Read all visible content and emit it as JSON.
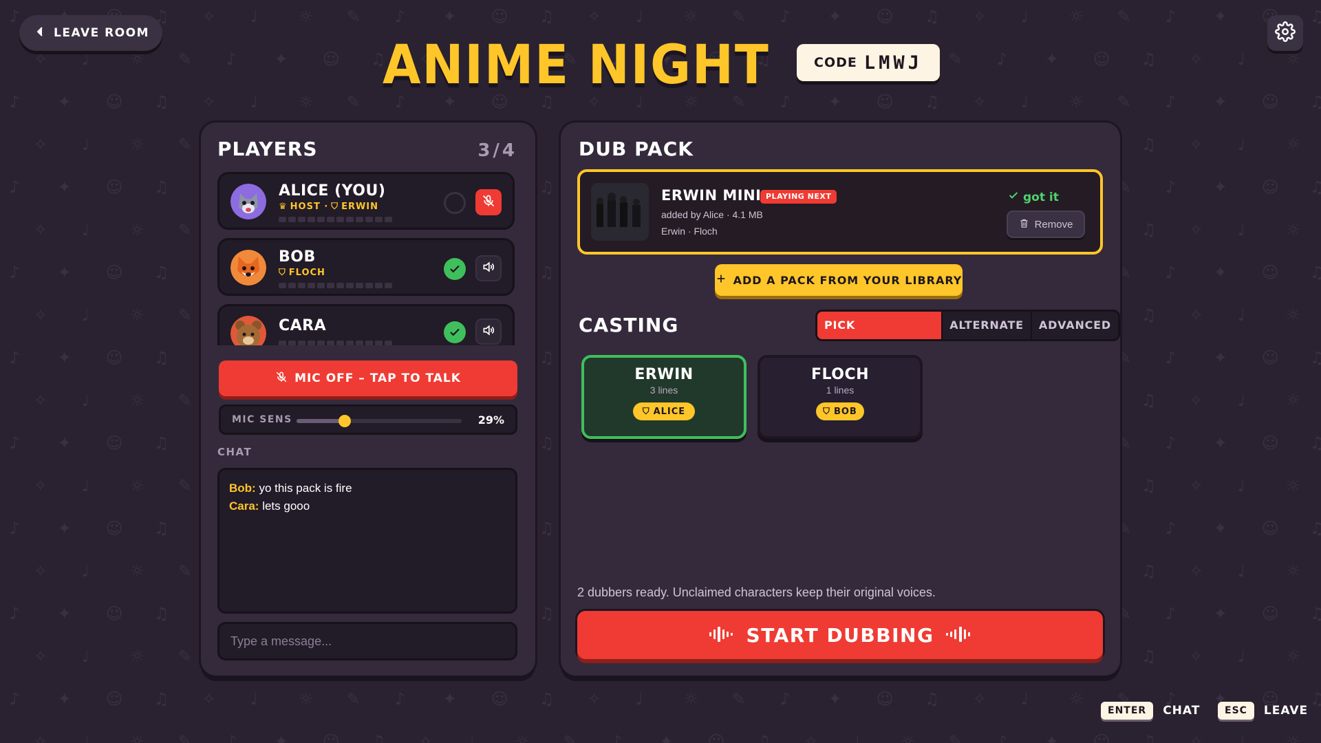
{
  "header": {
    "leave_label": "LEAVE ROOM",
    "title": "ANIME NIGHT",
    "code_label": "CODE",
    "code_value": "LMWJ"
  },
  "players": {
    "heading": "PLAYERS",
    "count": "3/4",
    "list": [
      {
        "name": "ALICE (YOU)",
        "role": "HOST · ",
        "character": "ERWIN",
        "ready": false,
        "mic": "muted"
      },
      {
        "name": "BOB",
        "role": "",
        "character": "FLOCH",
        "ready": true,
        "mic": "speaker"
      },
      {
        "name": "CARA",
        "role": "",
        "character": "",
        "ready": true,
        "mic": "speaker"
      }
    ],
    "mic_button_label": "MIC OFF – TAP TO TALK",
    "mic_sens_label": "MIC SENS",
    "mic_sens_value": "29%",
    "mic_sens_fraction": 0.29
  },
  "chat": {
    "label": "CHAT",
    "messages": [
      {
        "author": "Bob:",
        "text": " yo this pack is fire"
      },
      {
        "author": "Cara:",
        "text": " lets gooo"
      }
    ],
    "placeholder": "Type a message..."
  },
  "dub_pack": {
    "heading": "DUB PACK",
    "pack": {
      "name": "ERWIN MINI",
      "badge": "PLAYING NEXT",
      "meta": "added by Alice · 4.1 MB",
      "characters": "Erwin · Floch",
      "status": "got it",
      "remove_label": "Remove"
    },
    "add_label": "ADD A PACK FROM YOUR LIBRARY"
  },
  "casting": {
    "heading": "CASTING",
    "tabs": [
      {
        "label": "PICK CHARACTERS",
        "active": true
      },
      {
        "label": "ALTERNATE",
        "active": false
      },
      {
        "label": "ADVANCED",
        "active": false
      }
    ],
    "characters": [
      {
        "name": "ERWIN",
        "lines": "3 lines",
        "assignee": "ALICE",
        "selected": true
      },
      {
        "name": "FLOCH",
        "lines": "1 lines",
        "assignee": "BOB",
        "selected": false
      }
    ],
    "ready_text": "2 dubbers ready. Unclaimed characters keep their original voices.",
    "start_label": "START DUBBING"
  },
  "hints": [
    {
      "key": "ENTER",
      "label": "CHAT"
    },
    {
      "key": "ESC",
      "label": "LEAVE"
    }
  ],
  "colors": {
    "background": "#2a2230",
    "accent_yellow": "#ffc629",
    "accent_red": "#ef3b33",
    "ready_green": "#4ed36c"
  }
}
